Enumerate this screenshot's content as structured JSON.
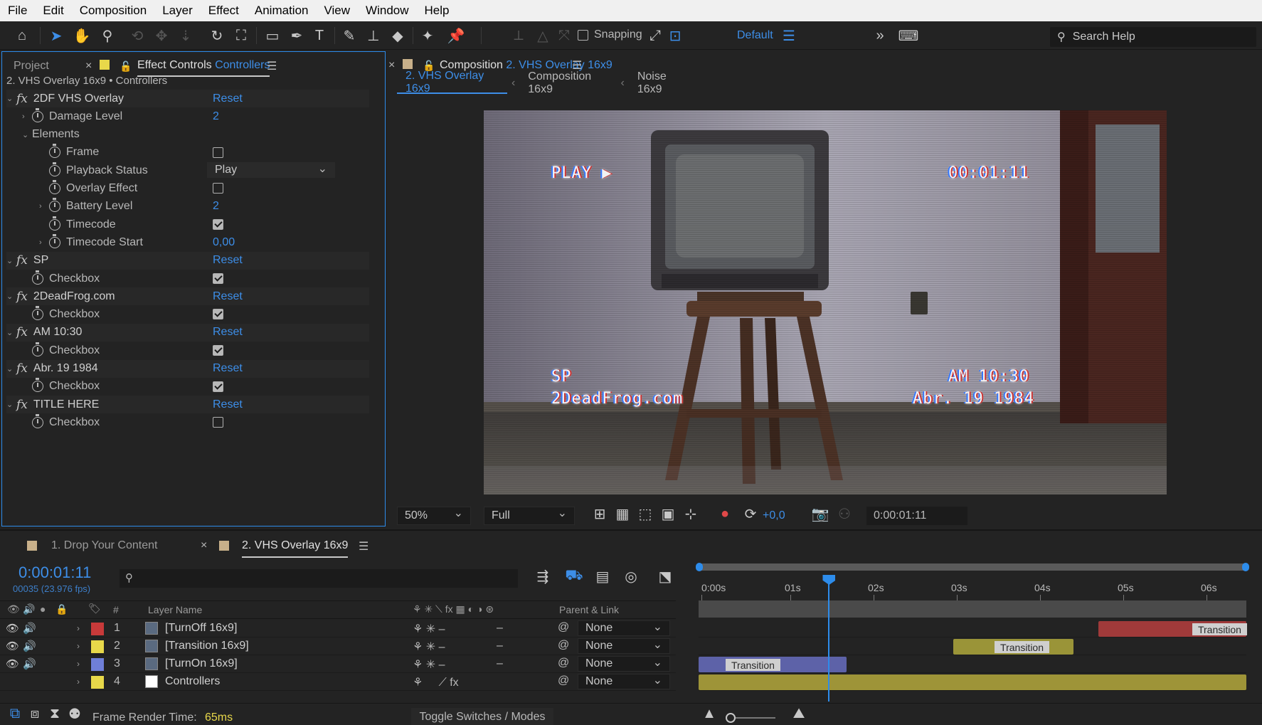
{
  "menu": [
    "File",
    "Edit",
    "Composition",
    "Layer",
    "Effect",
    "Animation",
    "View",
    "Window",
    "Help"
  ],
  "toolbar": {
    "snapping_label": "Snapping",
    "workspace": "Default",
    "search_placeholder": "Search Help"
  },
  "effect_controls": {
    "tab_project": "Project",
    "tab_ec_prefix": "Effect Controls",
    "tab_ec_layer": "Controllers",
    "header": "2. VHS Overlay 16x9 • Controllers",
    "rows": [
      {
        "type": "fx",
        "label": "2DF VHS Overlay",
        "value": "Reset"
      },
      {
        "type": "prop",
        "label": "Damage Level",
        "value": "2"
      },
      {
        "type": "group",
        "label": "Elements"
      },
      {
        "type": "check",
        "label": "Frame",
        "checked": false
      },
      {
        "type": "select",
        "label": "Playback Status",
        "value": "Play"
      },
      {
        "type": "check",
        "label": "Overlay Effect",
        "checked": false
      },
      {
        "type": "prop",
        "label": "Battery Level",
        "value": "2"
      },
      {
        "type": "check",
        "label": "Timecode",
        "checked": true
      },
      {
        "type": "prop",
        "label": "Timecode Start",
        "value": "0,00"
      },
      {
        "type": "fx",
        "label": "SP",
        "value": "Reset"
      },
      {
        "type": "check",
        "label": "Checkbox",
        "checked": true
      },
      {
        "type": "fx",
        "label": "2DeadFrog.com",
        "value": "Reset"
      },
      {
        "type": "check",
        "label": "Checkbox",
        "checked": true
      },
      {
        "type": "fx",
        "label": "AM 10:30",
        "value": "Reset"
      },
      {
        "type": "check",
        "label": "Checkbox",
        "checked": true
      },
      {
        "type": "fx",
        "label": "Abr. 19 1984",
        "value": "Reset"
      },
      {
        "type": "check",
        "label": "Checkbox",
        "checked": true
      },
      {
        "type": "fx",
        "label": "TITLE HERE",
        "value": "Reset"
      },
      {
        "type": "check",
        "label": "Checkbox",
        "checked": false
      }
    ]
  },
  "composition": {
    "tab_prefix": "Composition",
    "tab_name": "2. VHS Overlay 16x9",
    "breadcrumbs": [
      "2. VHS Overlay 16x9",
      "Composition 16x9",
      "Noise 16x9"
    ],
    "overlay": {
      "play": "PLAY ▶",
      "timecode": "00:01:11",
      "sp": "SP",
      "site": "2DeadFrog.com",
      "time": "AM 10:30",
      "date": "Abr. 19 1984"
    },
    "zoom": "50%",
    "resolution": "Full",
    "exposure": "+0,0",
    "current_time": "0:00:01:11"
  },
  "timeline": {
    "tabs": [
      "1. Drop Your Content",
      "2. VHS Overlay 16x9"
    ],
    "current_time": "0:00:01:11",
    "frame_info": "00035 (23.976 fps)",
    "col_hash": "#",
    "col_layer_name": "Layer Name",
    "col_parent": "Parent & Link",
    "ruler": [
      "0:00s",
      "01s",
      "02s",
      "03s",
      "04s",
      "05s",
      "06s"
    ],
    "layers": [
      {
        "num": "1",
        "name": "[TurnOff 16x9]",
        "color": "#c83a3a",
        "parent": "None",
        "bar_start": 0.73,
        "bar_end": 1.0,
        "bar_color": "#a03a3a",
        "label": "Transition"
      },
      {
        "num": "2",
        "name": "[Transition 16x9]",
        "color": "#e8d84a",
        "parent": "None",
        "bar_start": 0.465,
        "bar_end": 0.685,
        "bar_color": "#9a9438",
        "label": "Transition"
      },
      {
        "num": "3",
        "name": "[TurnOn 16x9]",
        "color": "#6f7fd8",
        "parent": "None",
        "bar_start": 0.0,
        "bar_end": 0.27,
        "bar_color": "#5d62a8",
        "label": "Transition"
      },
      {
        "num": "4",
        "name": "Controllers",
        "color": "#e8d84a",
        "parent": "None",
        "bar_start": 0.0,
        "bar_end": 1.0,
        "bar_color": "#9e9438",
        "label": ""
      }
    ],
    "playhead_fraction": 0.237,
    "frame_render_label": "Frame Render Time:",
    "frame_render_value": "65ms",
    "toggle_label": "Toggle Switches / Modes"
  },
  "colors": {
    "accent": "#3d8ee8",
    "panel": "#232323"
  }
}
